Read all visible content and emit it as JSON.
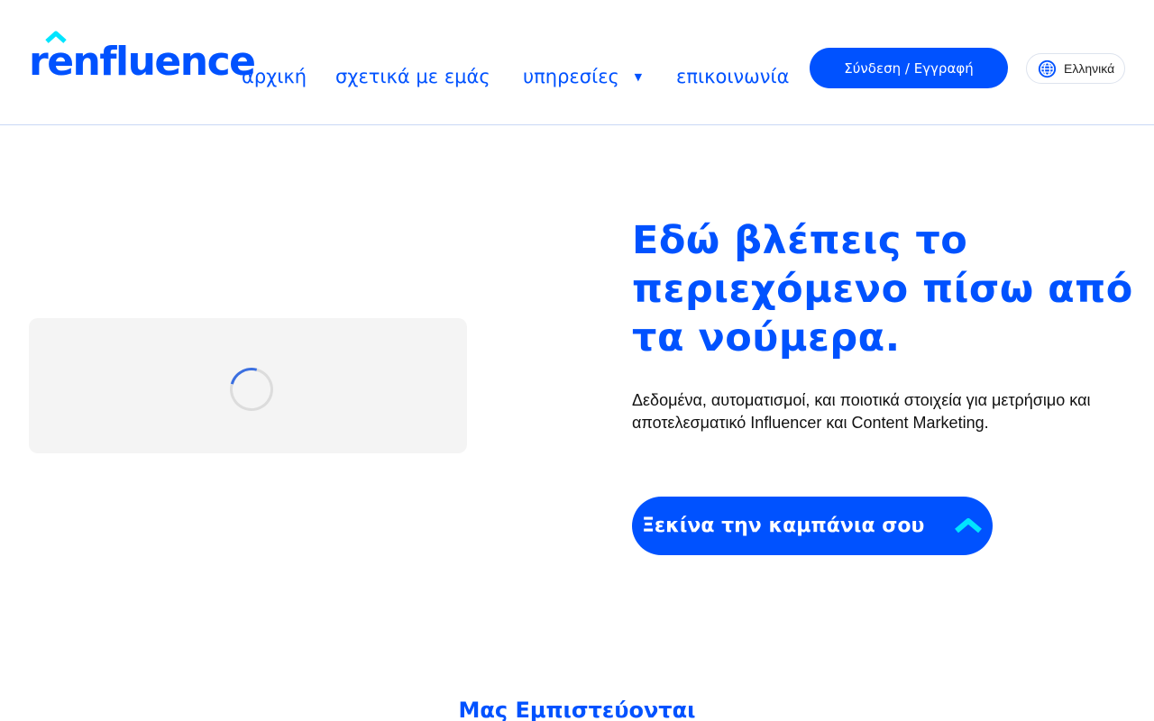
{
  "brand": {
    "logo_text": "renfluence",
    "primary_color": "#0052ff",
    "accent_color": "#00e5ff"
  },
  "nav": {
    "items": [
      {
        "label": "αρχική"
      },
      {
        "label": "σχετικά με εμάς"
      },
      {
        "label": "υπηρεσίες",
        "has_dropdown": true,
        "arrow": "▼"
      },
      {
        "label": "επικοινωνία"
      }
    ]
  },
  "header": {
    "login_label": "Σύνδεση / Εγγραφή",
    "language_label": "Ελληνικά",
    "language_icon": "globe-icon"
  },
  "hero": {
    "title": "Εδώ βλέπεις το περιεχόμενο πίσω από τα νούμερα.",
    "description": "Δεδομένα, αυτοματισμοί, και ποιοτικά στοιχεία για μετρήσιμο και αποτελεσματικό Influencer και Content Marketing.",
    "cta_label": "Ξεκίνα την καμπάνια σου",
    "cta_icon": "chevron-up-icon",
    "media_state": "loading"
  },
  "trusted": {
    "title": "Μας Εμπιστεύονται"
  }
}
